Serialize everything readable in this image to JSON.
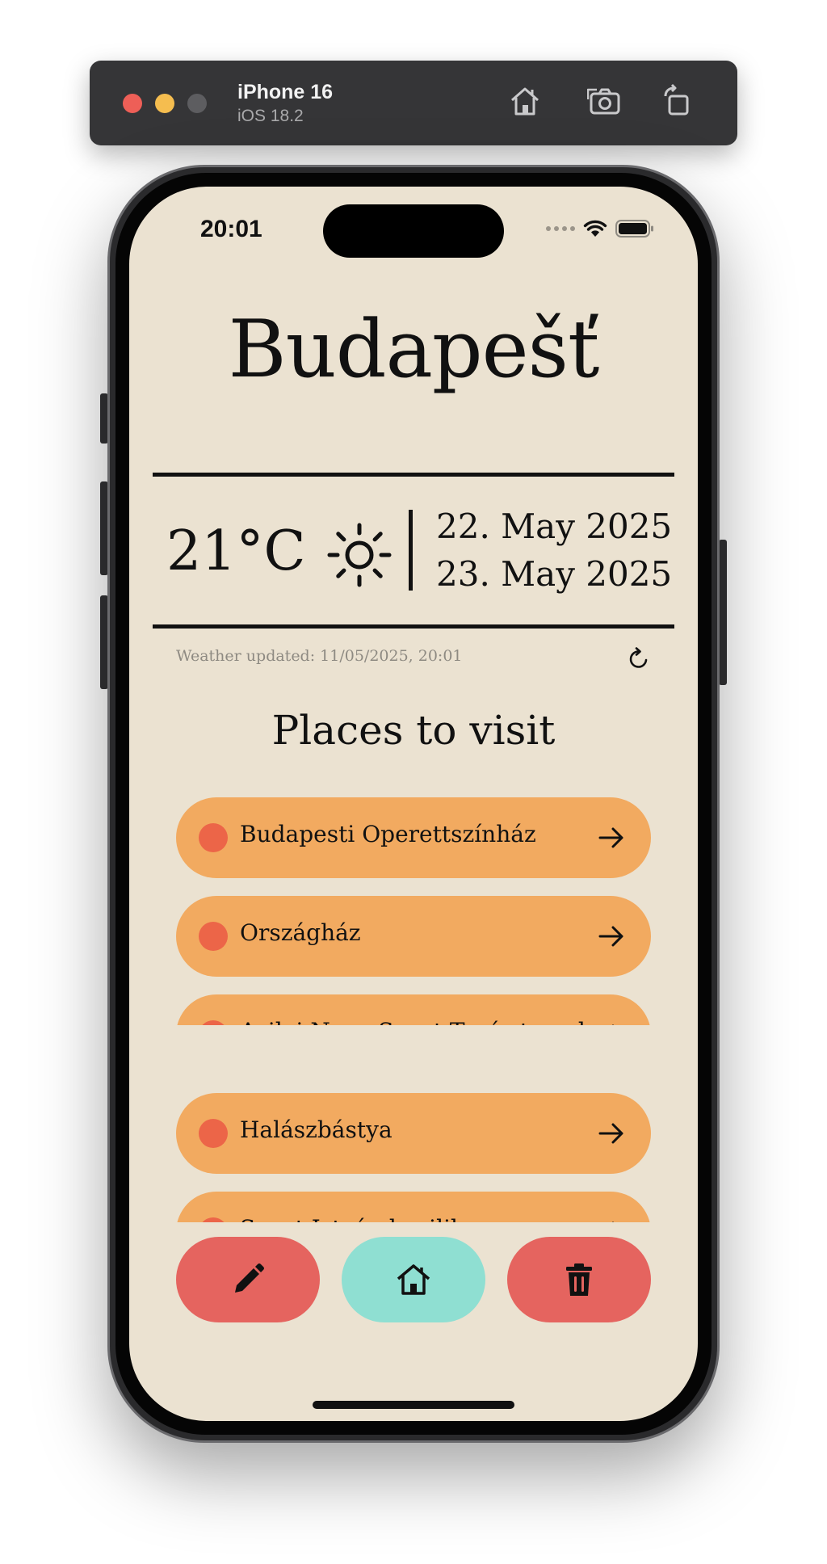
{
  "simulator": {
    "device_name": "iPhone 16",
    "os_version": "iOS 18.2",
    "icons": [
      "home-icon",
      "screenshot-icon",
      "rotate-icon"
    ]
  },
  "status_bar": {
    "time": "20:01",
    "icons": [
      "signal-dots-icon",
      "wifi-icon",
      "battery-icon"
    ]
  },
  "city": {
    "name": "Budapešť"
  },
  "weather": {
    "temperature": "21°C",
    "condition_icon": "sun-icon",
    "dates": [
      "22. May 2025",
      "23. May 2025"
    ],
    "updated_text": "Weather updated: 11/05/2025, 20:01"
  },
  "places": {
    "title": "Places to visit",
    "items": [
      {
        "label": "Budapesti Operettszínház"
      },
      {
        "label": "Országház"
      },
      {
        "label": "Avilai Nagy Szent Teréz templom"
      },
      {
        "label": "Halászbástya"
      },
      {
        "label": "Szent István bazilika"
      }
    ]
  },
  "actions": {
    "buttons": [
      "edit-button",
      "home-button",
      "delete-button"
    ]
  },
  "colors": {
    "background": "#ebe2d1",
    "place_card": "#f2aa60",
    "place_dot": "#ec6548",
    "action_red": "#e5645f",
    "action_teal": "#8fdfd2"
  }
}
